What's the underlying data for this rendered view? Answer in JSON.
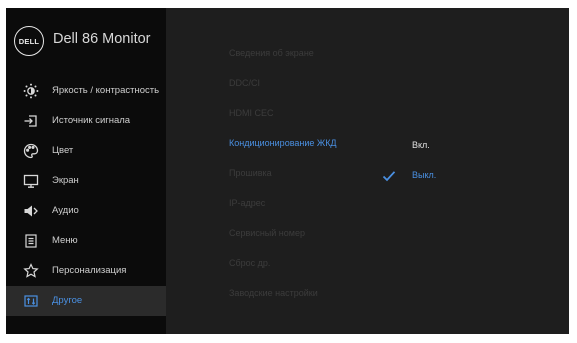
{
  "header": {
    "logo": "DELL",
    "title": "Dell 86 Monitor"
  },
  "sidebar": {
    "items": [
      {
        "label": "Яркость / контрастность",
        "icon": "brightness-icon"
      },
      {
        "label": "Источник сигнала",
        "icon": "input-source-icon"
      },
      {
        "label": "Цвет",
        "icon": "color-palette-icon"
      },
      {
        "label": "Экран",
        "icon": "display-icon"
      },
      {
        "label": "Аудио",
        "icon": "speaker-icon"
      },
      {
        "label": "Меню",
        "icon": "menu-icon"
      },
      {
        "label": "Персонализация",
        "icon": "star-icon"
      },
      {
        "label": "Другое",
        "icon": "other-icon",
        "active": true
      }
    ]
  },
  "main": {
    "options": [
      "Сведения об экране",
      "DDC/CI",
      "HDMI CEC",
      "Кондиционирование ЖКД",
      "Прошивка",
      "IP-адрес",
      "Сервисный номер",
      "Сброс др.",
      "Заводские настройки"
    ],
    "active_option": "Кондиционирование ЖКД",
    "choices": [
      {
        "label": "Вкл.",
        "selected": false
      },
      {
        "label": "Выкл.",
        "selected": true
      }
    ]
  },
  "colors": {
    "accent": "#4a90e2",
    "sidebar_bg": "#0b0b0b",
    "panel_bg": "#1e1e1e"
  }
}
